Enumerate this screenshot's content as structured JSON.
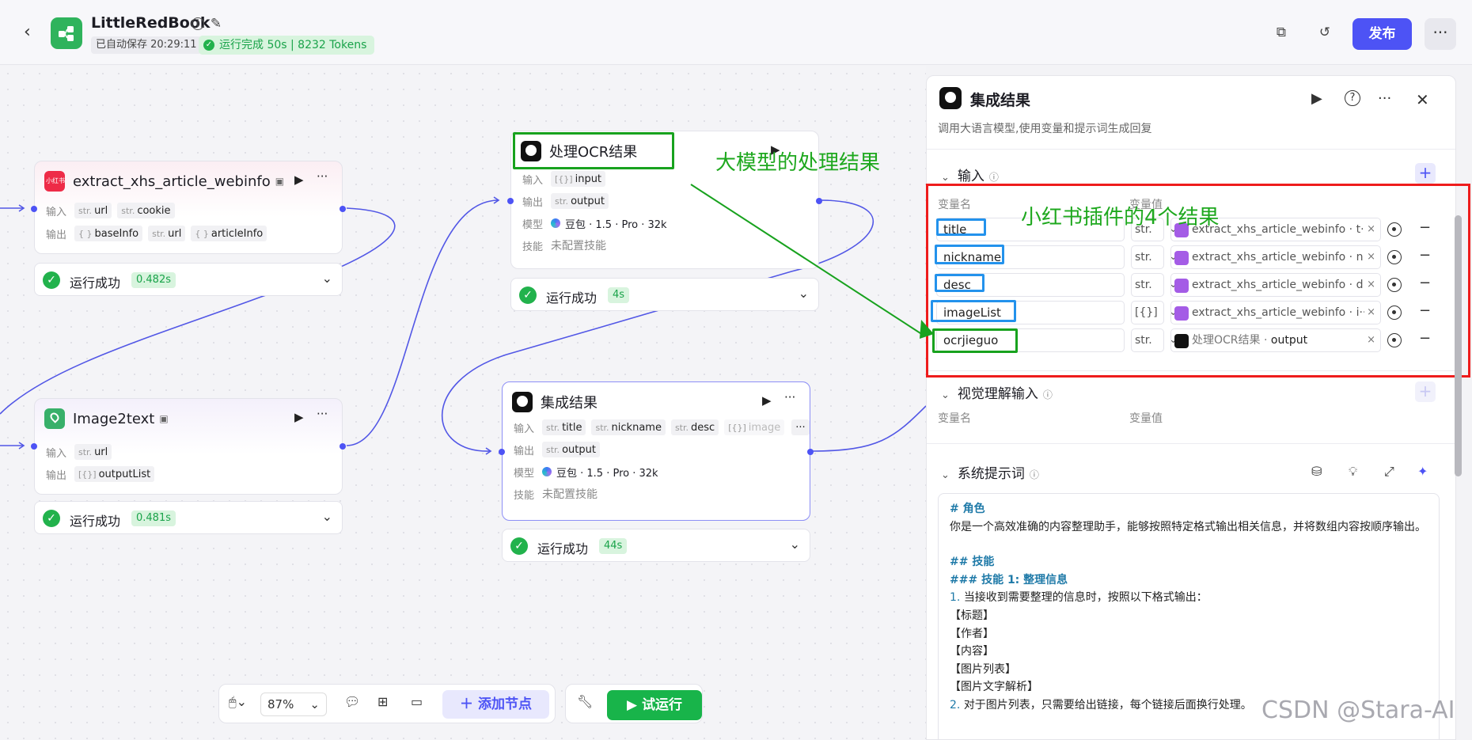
{
  "header": {
    "app_name": "LittleRedBook",
    "autosave": "已自动保存 20:29:11",
    "run_status": "运行完成 50s | 8232 Tokens",
    "publish_label": "发布"
  },
  "nodes": {
    "extract": {
      "title": "extract_xhs_article_webinfo",
      "icon_text": "小红书",
      "input_label": "输入",
      "inputs": [
        {
          "type": "str.",
          "name": "url"
        },
        {
          "type": "str.",
          "name": "cookie"
        }
      ],
      "output_label": "输出",
      "outputs": [
        {
          "type": "{ }",
          "name": "baseInfo"
        },
        {
          "type": "str.",
          "name": "url"
        },
        {
          "type": "{ }",
          "name": "articleInfo"
        }
      ],
      "status": "运行成功",
      "time": "0.482s"
    },
    "image2text": {
      "title": "Image2text",
      "input_label": "输入",
      "inputs": [
        {
          "type": "str.",
          "name": "url"
        }
      ],
      "output_label": "输出",
      "outputs": [
        {
          "type": "[{}]",
          "name": "outputList"
        }
      ],
      "status": "运行成功",
      "time": "0.481s"
    },
    "ocr": {
      "title": "处理OCR结果",
      "input_label": "输入",
      "inputs": [
        {
          "type": "[{}]",
          "name": "input"
        }
      ],
      "output_label": "输出",
      "outputs": [
        {
          "type": "str.",
          "name": "output"
        }
      ],
      "model_label": "模型",
      "model": "豆包 · 1.5 · Pro · 32k",
      "skill_label": "技能",
      "skill": "未配置技能",
      "status": "运行成功",
      "time": "4s"
    },
    "merge": {
      "title": "集成结果",
      "input_label": "输入",
      "inputs": [
        {
          "type": "str.",
          "name": "title"
        },
        {
          "type": "str.",
          "name": "nickname"
        },
        {
          "type": "str.",
          "name": "desc"
        },
        {
          "type": "[{}]",
          "name": "image"
        }
      ],
      "output_label": "输出",
      "outputs": [
        {
          "type": "str.",
          "name": "output"
        }
      ],
      "model_label": "模型",
      "model": "豆包 · 1.5 · Pro · 32k",
      "skill_label": "技能",
      "skill": "未配置技能",
      "status": "运行成功",
      "time": "44s"
    }
  },
  "annotations": {
    "llm": "大模型的处理结果",
    "plugin": "小红书插件的4个结果"
  },
  "toolbar": {
    "zoom": "87%",
    "add_node": "添加节点",
    "try_run": "试运行"
  },
  "panel": {
    "title": "集成结果",
    "description": "调用大语言模型,使用变量和提示词生成回复",
    "input_section": "输入",
    "col_name": "变量名",
    "col_value": "变量值",
    "variables": [
      {
        "name": "title",
        "type": "str.",
        "value": "extract_xhs_article_webinfo · t···"
      },
      {
        "name": "nickname",
        "type": "str.",
        "value": "extract_xhs_article_webinfo · n···"
      },
      {
        "name": "desc",
        "type": "str.",
        "value": "extract_xhs_article_webinfo · d···"
      },
      {
        "name": "imageList",
        "type": "[{}]",
        "value": "extract_xhs_article_webinfo · i···"
      },
      {
        "name": "ocrjieguo",
        "type": "str.",
        "value_source": "处理OCR结果",
        "value_field": "output"
      }
    ],
    "vision_section": "视觉理解输入",
    "vision_col_name": "变量名",
    "vision_col_value": "变量值",
    "prompt_section": "系统提示词",
    "prompt": {
      "h_role": "# 角色",
      "role_text": "你是一个高效准确的内容整理助手，能够按照特定格式输出相关信息，并将数组内容按顺序输出。",
      "h_skill": "## 技能",
      "h_skill1": "### 技能 1: 整理信息",
      "item1_num": "1.",
      "item1": "当接收到需要整理的信息时，按照以下格式输出：",
      "fmt1": "【标题】",
      "fmt2": "【作者】",
      "fmt3": "【内容】",
      "fmt4": "【图片列表】",
      "fmt5": "【图片文字解析】",
      "item2_num": "2.",
      "item2": "对于图片列表，只需要给出链接，每个链接后面换行处理。"
    }
  },
  "watermark": "CSDN @Stara-AI"
}
